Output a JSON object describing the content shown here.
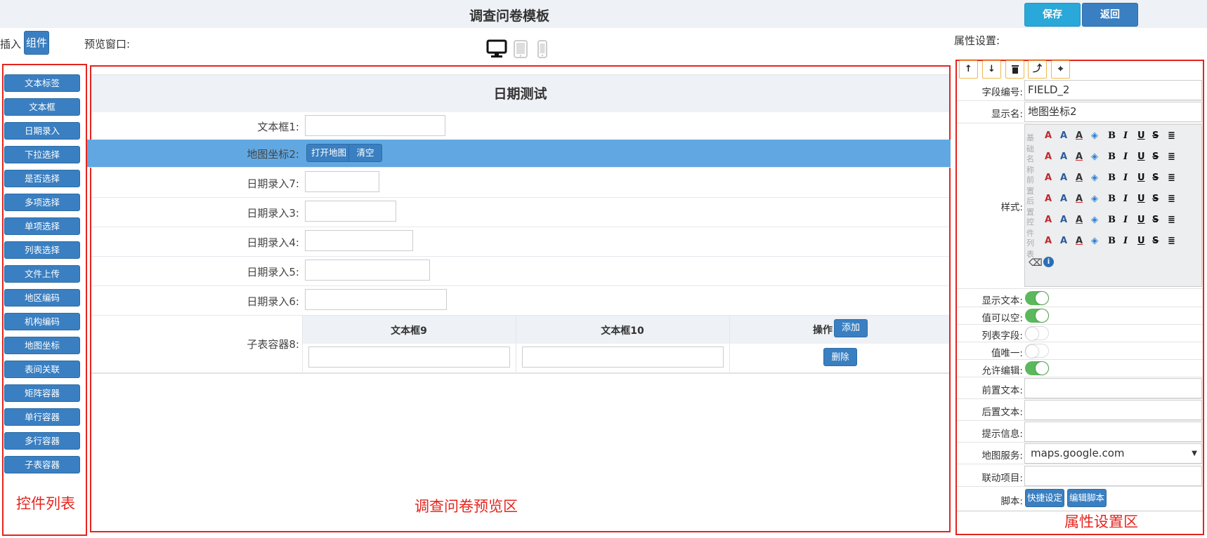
{
  "header": {
    "title": "调查问卷模板",
    "save_label": "保存",
    "back_label": "返回"
  },
  "toolbar": {
    "insert_label": "插入",
    "component_button": "组件",
    "preview_label": "预览窗口:",
    "properties_label": "属性设置:"
  },
  "device_icons": [
    "desktop-icon",
    "tablet-icon",
    "phone-icon"
  ],
  "components": [
    "文本标签",
    "文本框",
    "日期录入",
    "下拉选择",
    "是否选择",
    "多项选择",
    "单项选择",
    "列表选择",
    "文件上传",
    "地区编码",
    "机构编码",
    "地图坐标",
    "表间关联",
    "矩阵容器",
    "单行容器",
    "多行容器",
    "子表容器"
  ],
  "annotations": {
    "components": "控件列表",
    "preview": "调查问卷预览区",
    "properties": "属性设置区"
  },
  "form": {
    "title": "日期测试",
    "text_label": "文本框1:",
    "text_value": "",
    "map_label": "地图坐标2:",
    "open_map": "打开地图",
    "clear": "清空",
    "dates": [
      {
        "label": "日期录入7:",
        "value": ""
      },
      {
        "label": "日期录入3:",
        "value": ""
      },
      {
        "label": "日期录入4:",
        "value": ""
      },
      {
        "label": "日期录入5:",
        "value": ""
      },
      {
        "label": "日期录入6:",
        "value": ""
      }
    ],
    "subtable": {
      "label": "子表容器8:",
      "col1": "文本框9",
      "col2": "文本框10",
      "op": "操作",
      "add": "添加",
      "delete": "删除",
      "col1_value": "",
      "col2_value": ""
    }
  },
  "properties": {
    "toolbar_icons": [
      "arrow-up-icon",
      "arrow-down-icon",
      "trash-icon",
      "move-up-icon",
      "crosshair-icon"
    ],
    "field_id_label": "字段编号:",
    "field_id": "FIELD_2",
    "display_name_label": "显示名:",
    "display_name": "地图坐标2",
    "style_label": "样式:",
    "style_rows": [
      "基础",
      "名称",
      "前置",
      "后置",
      "控件",
      "列表"
    ],
    "show_text_label": "显示文本:",
    "show_text": true,
    "nullable_label": "值可以空:",
    "nullable": true,
    "list_field_label": "列表字段:",
    "list_field": false,
    "unique_label": "值唯一:",
    "unique": false,
    "editable_label": "允许编辑:",
    "editable": true,
    "prefix_label": "前置文本:",
    "prefix": "",
    "suffix_label": "后置文本:",
    "suffix": "",
    "hint_label": "提示信息:",
    "hint": "",
    "map_service_label": "地图服务:",
    "map_service": "maps.google.com",
    "linked_label": "联动项目:",
    "linked": "",
    "script_label": "脚本:",
    "quick_set": "快捷设定",
    "edit_script": "编辑脚本"
  }
}
